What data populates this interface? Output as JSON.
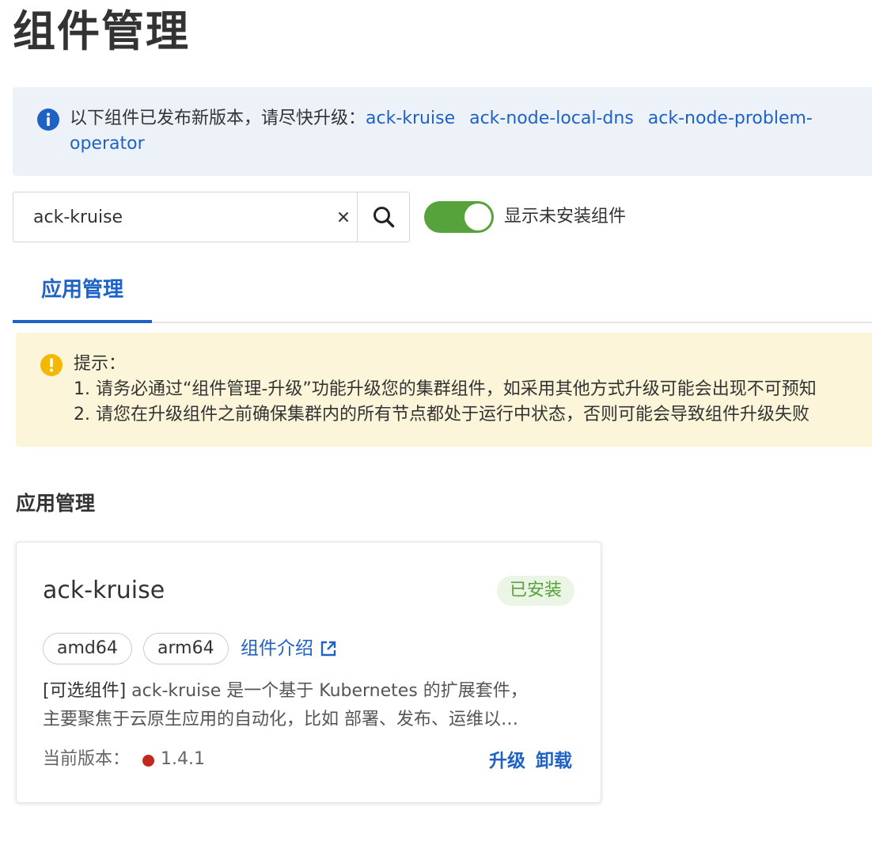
{
  "page": {
    "title": "组件管理"
  },
  "update_notice": {
    "prefix": "以下组件已发布新版本，请尽快升级：",
    "links": [
      "ack-kruise",
      "ack-node-local-dns",
      "ack-node-problem-",
      "operator"
    ]
  },
  "search": {
    "value": "ack-kruise",
    "clear_symbol": "×"
  },
  "toggle": {
    "label": "显示未安装组件",
    "on": true
  },
  "tabs": [
    {
      "label": "应用管理",
      "active": true
    }
  ],
  "tip": {
    "title": "提示：",
    "lines": [
      "1. 请务必通过“组件管理-升级”功能升级您的集群组件，如采用其他方式升级可能会出现不可预知",
      "2. 请您在升级组件之前确保集群内的所有节点都处于运行中状态，否则可能会导致组件升级失败"
    ]
  },
  "section": {
    "title": "应用管理"
  },
  "card": {
    "name": "ack-kruise",
    "status": "已安装",
    "tags": [
      "amd64",
      "arm64"
    ],
    "doc_link": "组件介绍",
    "description_prefix": "[可选组件]",
    "description_line1": " ack-kruise 是一个基于 Kubernetes 的扩展套件，",
    "description_line2": "主要聚焦于云原生应用的自动化，比如 部署、发布、运维以…",
    "version_label": "当前版本：",
    "version": "1.4.1",
    "actions": {
      "upgrade": "升级",
      "uninstall": "卸载"
    }
  },
  "colors": {
    "accent": "#1f62c6",
    "toggle_on": "#55a33a",
    "status_installed": "#56a13c",
    "version_dot": "#c1281e",
    "info_bg": "#edf2f8",
    "warn_bg": "#fcf5d9",
    "warn_icon": "#f5b800"
  },
  "icons": {
    "info": "info-circle-icon",
    "warning": "warning-circle-icon",
    "search": "search-icon",
    "clear": "close-icon",
    "external": "external-link-icon"
  }
}
